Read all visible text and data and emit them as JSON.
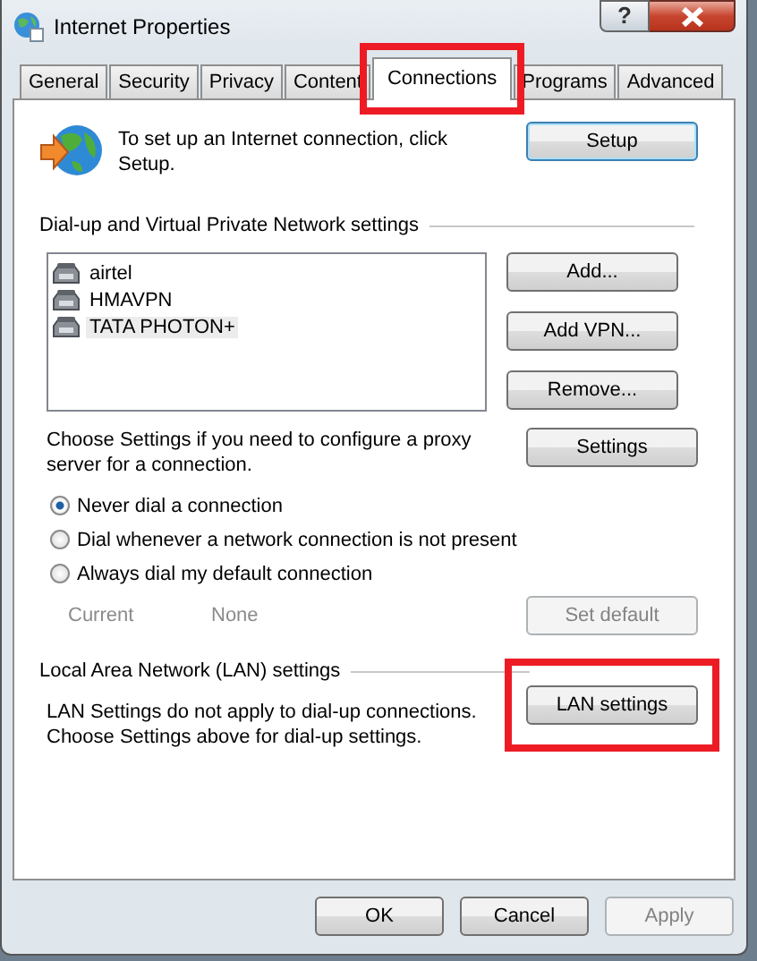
{
  "window": {
    "title": "Internet Properties",
    "help_button": "?"
  },
  "tabs": [
    {
      "label": "General",
      "selected": false,
      "highlighted": false
    },
    {
      "label": "Security",
      "selected": false,
      "highlighted": false
    },
    {
      "label": "Privacy",
      "selected": false,
      "highlighted": false
    },
    {
      "label": "Content",
      "selected": false,
      "highlighted": false
    },
    {
      "label": "Connections",
      "selected": true,
      "highlighted": true
    },
    {
      "label": "Programs",
      "selected": false,
      "highlighted": false
    },
    {
      "label": "Advanced",
      "selected": false,
      "highlighted": false
    }
  ],
  "setup": {
    "text": "To set up an Internet connection, click Setup.",
    "button": {
      "label": "Setup"
    }
  },
  "dialup": {
    "heading": "Dial-up and Virtual Private Network settings",
    "connections": [
      {
        "name": "airtel",
        "selected": false
      },
      {
        "name": "HMAVPN",
        "selected": false
      },
      {
        "name": "TATA PHOTON+",
        "selected": true
      }
    ],
    "buttons": [
      {
        "label": "Add..."
      },
      {
        "label": "Add VPN..."
      },
      {
        "label": "Remove..."
      }
    ],
    "proxy_text": "Choose Settings if you need to configure a proxy server for a connection.",
    "settings_button": {
      "label": "Settings"
    },
    "options": [
      {
        "label": "Never dial a connection",
        "selected": true
      },
      {
        "label": "Dial whenever a network connection is not present",
        "selected": false
      },
      {
        "label": "Always dial my default connection",
        "selected": false
      }
    ],
    "current_label": "Current",
    "current_value": "None",
    "set_default_button": {
      "label": "Set default",
      "disabled": true
    }
  },
  "lan": {
    "heading": "Local Area Network (LAN) settings",
    "text": "LAN Settings do not apply to dial-up connections. Choose Settings above for dial-up settings.",
    "button": {
      "label": "LAN settings",
      "highlighted": true
    }
  },
  "footer_buttons": [
    {
      "label": "OK",
      "disabled": false
    },
    {
      "label": "Cancel",
      "disabled": false
    },
    {
      "label": "Apply",
      "disabled": true
    }
  ]
}
